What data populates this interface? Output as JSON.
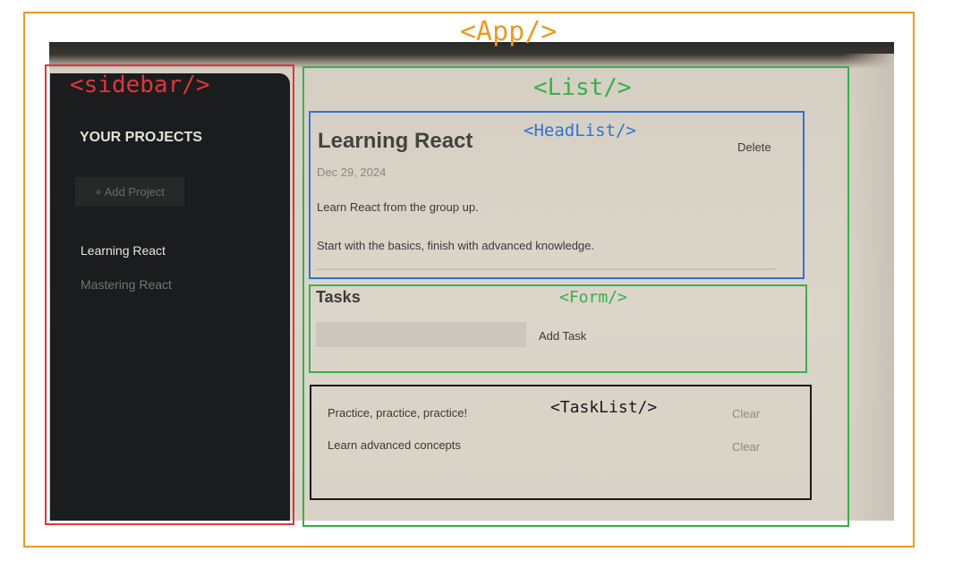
{
  "colors": {
    "app": "#ec9a23",
    "sidebar": "#e0343b",
    "list": "#3aae4d",
    "headlist": "#2f74cf",
    "form": "#3aae4d",
    "tasklist": "#1a1a1a"
  },
  "annotations": {
    "app": "<App/>",
    "sidebar": "<sidebar/>",
    "list": "<List/>",
    "headlist": "<HeadList/>",
    "form": "<Form/>",
    "tasklist": "<TaskList/>"
  },
  "sidebar": {
    "title": "YOUR PROJECTS",
    "add_button": "+ Add Project",
    "projects": [
      {
        "label": "Learning React"
      },
      {
        "label": "Mastering React"
      }
    ]
  },
  "project": {
    "title": "Learning React",
    "date": "Dec 29, 2024",
    "delete_label": "Delete",
    "description_lines": [
      "Learn React from the group up.",
      "Start with the basics, finish with advanced knowledge."
    ]
  },
  "tasks": {
    "title": "Tasks",
    "input_value": "",
    "add_label": "Add Task",
    "items": [
      {
        "text": "Practice, practice, practice!",
        "clear_label": "Clear"
      },
      {
        "text": "Learn advanced concepts",
        "clear_label": "Clear"
      }
    ]
  }
}
